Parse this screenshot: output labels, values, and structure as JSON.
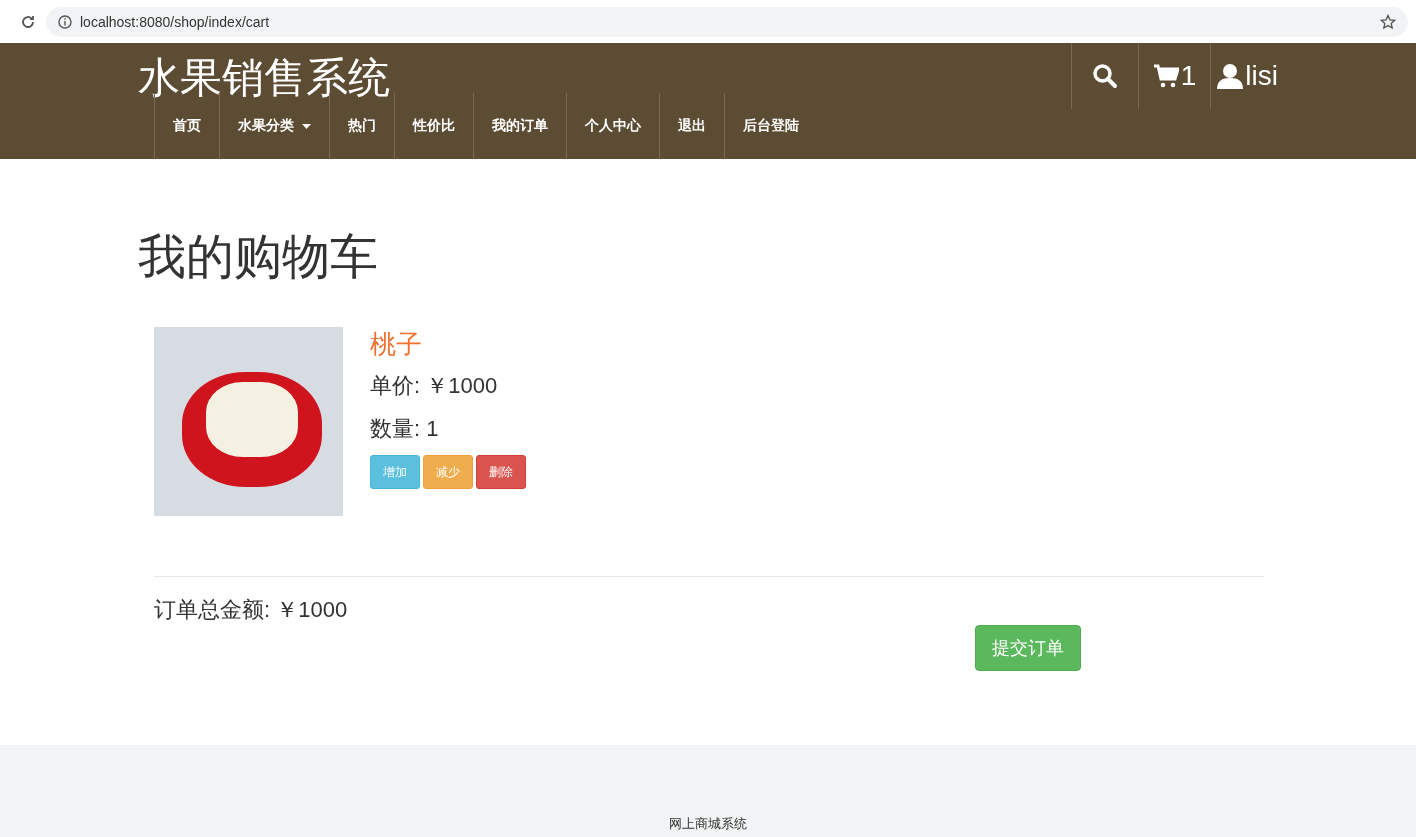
{
  "browser": {
    "url": "localhost:8080/shop/index/cart"
  },
  "header": {
    "brand": "水果销售系统",
    "cart_count": "1",
    "user": "lisi",
    "nav": [
      {
        "label": "首页",
        "dropdown": false
      },
      {
        "label": "水果分类",
        "dropdown": true
      },
      {
        "label": "热门",
        "dropdown": false
      },
      {
        "label": "性价比",
        "dropdown": false
      },
      {
        "label": "我的订单",
        "dropdown": false
      },
      {
        "label": "个人中心",
        "dropdown": false
      },
      {
        "label": "退出",
        "dropdown": false
      },
      {
        "label": "后台登陆",
        "dropdown": false
      }
    ]
  },
  "page_title": "我的购物车",
  "cart_items": [
    {
      "name": "桃子",
      "price": "单价: ￥1000",
      "quantity": "数量: 1",
      "actions": [
        {
          "label": "增加",
          "kind": "info"
        },
        {
          "label": "减少",
          "kind": "warning"
        },
        {
          "label": "删除",
          "kind": "danger"
        }
      ]
    }
  ],
  "total": "订单总金额: ￥1000",
  "submit_button": "提交订单",
  "footer": "网上商城系统"
}
